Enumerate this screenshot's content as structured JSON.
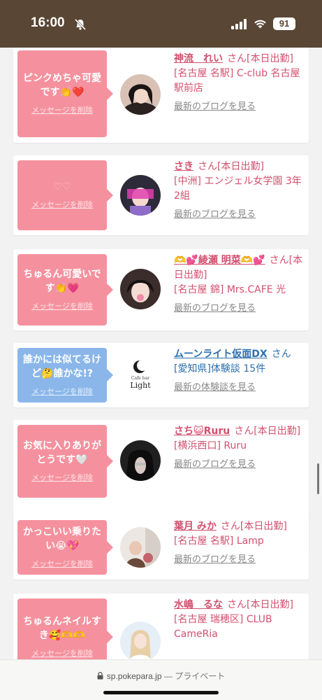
{
  "status_bar": {
    "time": "16:00",
    "battery": "91"
  },
  "entries": [
    {
      "message": "ピンクめちゃ可愛です👏❤️",
      "delete_label": "メッセージを削除",
      "name": "神流　れい",
      "suffix": "さん[本日出勤]",
      "location": "[名古屋 名駅] C-club 名古屋駅前店",
      "link": "最新のブログを見る"
    },
    {
      "message": "♡♡",
      "delete_label": "メッセージを削除",
      "name": "さき",
      "suffix": "さん[本日出勤]",
      "location": "[中洲] エンジェル女学園 3年2組",
      "link": "最新のブログを見る"
    },
    {
      "message": "ちゅるん可愛いです👏💗",
      "delete_label": "メッセージを削除",
      "name": "🫶💕綾瀬 明菜🫶💕",
      "suffix": "さん[本日出勤]",
      "location": "[名古屋 錦] Mrs.CAFE 光",
      "link": "最新のブログを見る"
    },
    {
      "message": "誰かには似てるけど🤔誰かな!?",
      "delete_label": "メッセージを削除",
      "name": "ムーンライト仮面DX",
      "suffix": "さん",
      "location": "[愛知県]体験談 15件",
      "link": "最新の体験談を見る",
      "avatar_text": "Light",
      "avatar_small": "Cafe bar"
    },
    {
      "message": "お気に入りありがとうです🤍",
      "delete_label": "メッセージを削除",
      "name": "さち😺Ruru",
      "suffix": "さん[本日出勤]",
      "location": "[横浜西口] Ruru",
      "link": "最新のブログを見る"
    },
    {
      "message": "かっこいい乗りたい😭💖",
      "delete_label": "メッセージを削除",
      "name": "葉月 みか",
      "suffix": "さん[本日出勤]",
      "location": "[名古屋 名駅] Lamp",
      "link": "最新のブログを見る"
    },
    {
      "message": "ちゅるんネイルすき🥰🫶🫶",
      "delete_label": "メッセージを削除",
      "name": "水嶋　るな",
      "suffix": "さん[本日出勤]",
      "location": "[名古屋 瑞穂区] CLUB CameRia",
      "link": ""
    }
  ],
  "browser": {
    "url": "sp.pokepara.jp",
    "mode": "— プライベート"
  },
  "colors": {
    "status_bar": "#5a4634",
    "pink_bubble": "#f5919e",
    "blue_bubble": "#8ab6ea",
    "name_pink": "#d2506e",
    "name_blue": "#2d6fae"
  }
}
